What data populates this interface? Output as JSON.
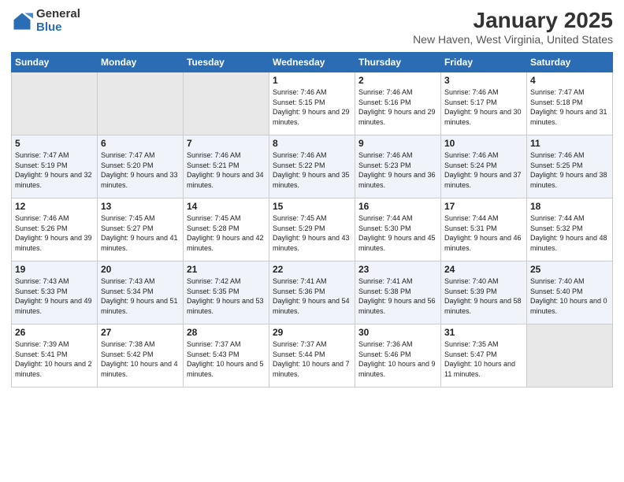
{
  "logo": {
    "general": "General",
    "blue": "Blue"
  },
  "title": "January 2025",
  "subtitle": "New Haven, West Virginia, United States",
  "headers": [
    "Sunday",
    "Monday",
    "Tuesday",
    "Wednesday",
    "Thursday",
    "Friday",
    "Saturday"
  ],
  "weeks": [
    [
      {
        "day": "",
        "info": ""
      },
      {
        "day": "",
        "info": ""
      },
      {
        "day": "",
        "info": ""
      },
      {
        "day": "1",
        "info": "Sunrise: 7:46 AM\nSunset: 5:15 PM\nDaylight: 9 hours and 29 minutes."
      },
      {
        "day": "2",
        "info": "Sunrise: 7:46 AM\nSunset: 5:16 PM\nDaylight: 9 hours and 29 minutes."
      },
      {
        "day": "3",
        "info": "Sunrise: 7:46 AM\nSunset: 5:17 PM\nDaylight: 9 hours and 30 minutes."
      },
      {
        "day": "4",
        "info": "Sunrise: 7:47 AM\nSunset: 5:18 PM\nDaylight: 9 hours and 31 minutes."
      }
    ],
    [
      {
        "day": "5",
        "info": "Sunrise: 7:47 AM\nSunset: 5:19 PM\nDaylight: 9 hours and 32 minutes."
      },
      {
        "day": "6",
        "info": "Sunrise: 7:47 AM\nSunset: 5:20 PM\nDaylight: 9 hours and 33 minutes."
      },
      {
        "day": "7",
        "info": "Sunrise: 7:46 AM\nSunset: 5:21 PM\nDaylight: 9 hours and 34 minutes."
      },
      {
        "day": "8",
        "info": "Sunrise: 7:46 AM\nSunset: 5:22 PM\nDaylight: 9 hours and 35 minutes."
      },
      {
        "day": "9",
        "info": "Sunrise: 7:46 AM\nSunset: 5:23 PM\nDaylight: 9 hours and 36 minutes."
      },
      {
        "day": "10",
        "info": "Sunrise: 7:46 AM\nSunset: 5:24 PM\nDaylight: 9 hours and 37 minutes."
      },
      {
        "day": "11",
        "info": "Sunrise: 7:46 AM\nSunset: 5:25 PM\nDaylight: 9 hours and 38 minutes."
      }
    ],
    [
      {
        "day": "12",
        "info": "Sunrise: 7:46 AM\nSunset: 5:26 PM\nDaylight: 9 hours and 39 minutes."
      },
      {
        "day": "13",
        "info": "Sunrise: 7:45 AM\nSunset: 5:27 PM\nDaylight: 9 hours and 41 minutes."
      },
      {
        "day": "14",
        "info": "Sunrise: 7:45 AM\nSunset: 5:28 PM\nDaylight: 9 hours and 42 minutes."
      },
      {
        "day": "15",
        "info": "Sunrise: 7:45 AM\nSunset: 5:29 PM\nDaylight: 9 hours and 43 minutes."
      },
      {
        "day": "16",
        "info": "Sunrise: 7:44 AM\nSunset: 5:30 PM\nDaylight: 9 hours and 45 minutes."
      },
      {
        "day": "17",
        "info": "Sunrise: 7:44 AM\nSunset: 5:31 PM\nDaylight: 9 hours and 46 minutes."
      },
      {
        "day": "18",
        "info": "Sunrise: 7:44 AM\nSunset: 5:32 PM\nDaylight: 9 hours and 48 minutes."
      }
    ],
    [
      {
        "day": "19",
        "info": "Sunrise: 7:43 AM\nSunset: 5:33 PM\nDaylight: 9 hours and 49 minutes."
      },
      {
        "day": "20",
        "info": "Sunrise: 7:43 AM\nSunset: 5:34 PM\nDaylight: 9 hours and 51 minutes."
      },
      {
        "day": "21",
        "info": "Sunrise: 7:42 AM\nSunset: 5:35 PM\nDaylight: 9 hours and 53 minutes."
      },
      {
        "day": "22",
        "info": "Sunrise: 7:41 AM\nSunset: 5:36 PM\nDaylight: 9 hours and 54 minutes."
      },
      {
        "day": "23",
        "info": "Sunrise: 7:41 AM\nSunset: 5:38 PM\nDaylight: 9 hours and 56 minutes."
      },
      {
        "day": "24",
        "info": "Sunrise: 7:40 AM\nSunset: 5:39 PM\nDaylight: 9 hours and 58 minutes."
      },
      {
        "day": "25",
        "info": "Sunrise: 7:40 AM\nSunset: 5:40 PM\nDaylight: 10 hours and 0 minutes."
      }
    ],
    [
      {
        "day": "26",
        "info": "Sunrise: 7:39 AM\nSunset: 5:41 PM\nDaylight: 10 hours and 2 minutes."
      },
      {
        "day": "27",
        "info": "Sunrise: 7:38 AM\nSunset: 5:42 PM\nDaylight: 10 hours and 4 minutes."
      },
      {
        "day": "28",
        "info": "Sunrise: 7:37 AM\nSunset: 5:43 PM\nDaylight: 10 hours and 5 minutes."
      },
      {
        "day": "29",
        "info": "Sunrise: 7:37 AM\nSunset: 5:44 PM\nDaylight: 10 hours and 7 minutes."
      },
      {
        "day": "30",
        "info": "Sunrise: 7:36 AM\nSunset: 5:46 PM\nDaylight: 10 hours and 9 minutes."
      },
      {
        "day": "31",
        "info": "Sunrise: 7:35 AM\nSunset: 5:47 PM\nDaylight: 10 hours and 11 minutes."
      },
      {
        "day": "",
        "info": ""
      }
    ]
  ]
}
